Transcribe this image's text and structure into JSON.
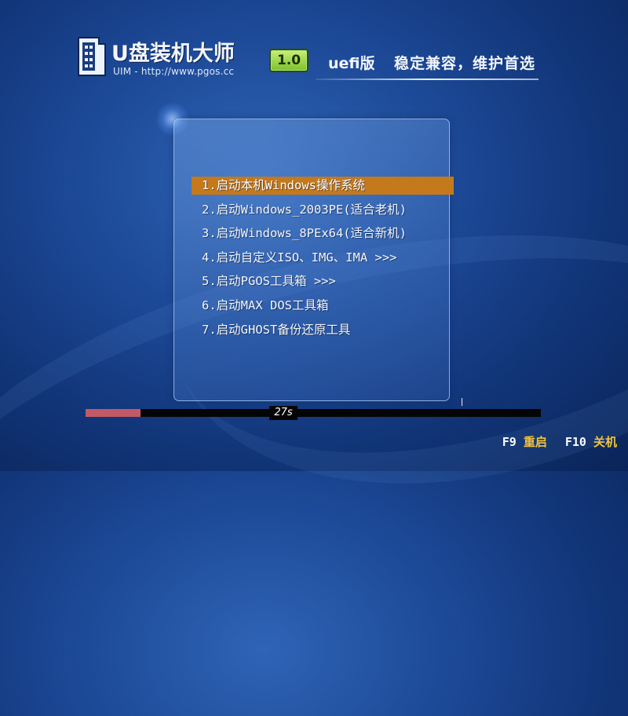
{
  "header": {
    "brand_title": "U盘装机大师",
    "brand_subtitle": "UIM - http://www.pgos.cc",
    "version": "1.0",
    "edition": "uefi版",
    "slogan": "稳定兼容，维护首选"
  },
  "menu": {
    "selected_index": 0,
    "items": [
      {
        "label": "1.启动本机Windows操作系统"
      },
      {
        "label": "2.启动Windows_2003PE(适合老机)"
      },
      {
        "label": "3.启动Windows_8PEx64(适合新机)"
      },
      {
        "label": "4.启动自定义ISO、IMG、IMA >>>"
      },
      {
        "label": "5.启动PGOS工具箱 >>>"
      },
      {
        "label": "6.启动MAX DOS工具箱"
      },
      {
        "label": "7.启动GHOST备份还原工具"
      }
    ]
  },
  "timer": {
    "countdown": "27s",
    "progress_fraction": 0.12
  },
  "function_keys": [
    {
      "key": "F9",
      "label": "重启"
    },
    {
      "key": "F10",
      "label": "关机"
    }
  ],
  "colors": {
    "selection": "#c4791c",
    "progress_fill": "#c25a66",
    "fkey_label": "#f2c33e",
    "version_badge": "#9bd84a"
  },
  "icons": {
    "logo": "usb-drive-icon"
  }
}
